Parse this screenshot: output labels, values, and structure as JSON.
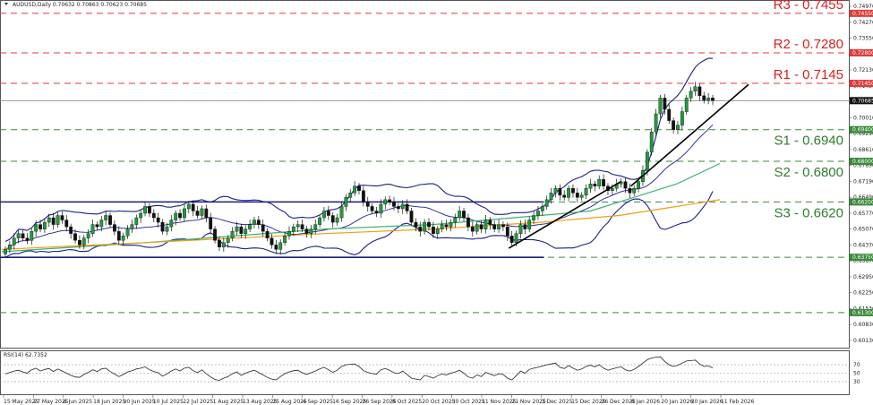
{
  "chart_data": {
    "type": "candlestick",
    "header": "AUDUSD,Daily  0.70632 0.70863 0.70623 0.70685",
    "ylim": [
      0.5975,
      0.751
    ],
    "y_ticks": [
      "0.74970",
      "0.74270",
      "0.73550",
      "0.72850",
      "0.72130",
      "0.71430",
      "0.70710",
      "0.70010",
      "0.69290",
      "0.68610",
      "0.67890",
      "0.67190",
      "0.66490",
      "0.65770",
      "0.65070",
      "0.64370",
      "0.63670",
      "0.62950",
      "0.62250",
      "0.61530",
      "0.60830",
      "0.60130"
    ],
    "x_ticks": [
      "15 May 2025",
      "27 May 2025",
      "6 Jun 2025",
      "18 Jun 2025",
      "30 Jun 2025",
      "10 Jul 2025",
      "22 Jul 2025",
      "1 Aug 2025",
      "13 Aug 2025",
      "25 Aug 2025",
      "4 Sep 2025",
      "16 Sep 2025",
      "26 Sep 2025",
      "8 Oct 2025",
      "20 Oct 2025",
      "30 Oct 2025",
      "11 Nov 2025",
      "21 Nov 2025",
      "3 Dec 2025",
      "15 Dec 2025",
      "26 Dec 2025",
      "8 Jan 2026",
      "20 Jan 2026",
      "30 Jan 2026",
      "11 Feb 2026"
    ],
    "current_price": {
      "value": 0.70685,
      "label": "0.70685"
    },
    "resistance": [
      {
        "name": "R3 - 0.7455",
        "value": 0.7455,
        "tag": "0.74550"
      },
      {
        "name": "R2 - 0.7280",
        "value": 0.728,
        "tag": "0.72800"
      },
      {
        "name": "R1 - 0.7145",
        "value": 0.7145,
        "tag": "0.71450"
      }
    ],
    "support": [
      {
        "name": "S1 - 0.6940",
        "value": 0.694,
        "tag": "0.69400"
      },
      {
        "name": "S2 - 0.6800",
        "value": 0.68,
        "tag": "0.68000"
      },
      {
        "name": "S3 - 0.6620",
        "value": 0.662,
        "tag": "0.66200"
      }
    ],
    "extra_levels": [
      {
        "value": 0.6375,
        "tag": "0.63750"
      },
      {
        "value": 0.613,
        "tag": "0.61300"
      }
    ],
    "range_lines": [
      0.662,
      0.6375
    ],
    "close_series": [
      0.641,
      0.643,
      0.646,
      0.648,
      0.646,
      0.645,
      0.649,
      0.652,
      0.65,
      0.653,
      0.655,
      0.652,
      0.656,
      0.654,
      0.651,
      0.648,
      0.645,
      0.643,
      0.646,
      0.648,
      0.652,
      0.651,
      0.654,
      0.656,
      0.652,
      0.649,
      0.645,
      0.647,
      0.65,
      0.652,
      0.655,
      0.657,
      0.66,
      0.657,
      0.655,
      0.653,
      0.649,
      0.651,
      0.654,
      0.657,
      0.655,
      0.659,
      0.661,
      0.658,
      0.656,
      0.659,
      0.655,
      0.65,
      0.645,
      0.642,
      0.644,
      0.646,
      0.649,
      0.651,
      0.648,
      0.65,
      0.652,
      0.654,
      0.652,
      0.649,
      0.646,
      0.643,
      0.641,
      0.644,
      0.647,
      0.649,
      0.651,
      0.652,
      0.65,
      0.648,
      0.65,
      0.652,
      0.655,
      0.658,
      0.656,
      0.653,
      0.655,
      0.66,
      0.664,
      0.666,
      0.669,
      0.667,
      0.662,
      0.66,
      0.658,
      0.657,
      0.661,
      0.663,
      0.662,
      0.66,
      0.659,
      0.661,
      0.658,
      0.653,
      0.651,
      0.649,
      0.653,
      0.651,
      0.648,
      0.65,
      0.652,
      0.651,
      0.653,
      0.655,
      0.658,
      0.655,
      0.651,
      0.649,
      0.652,
      0.65,
      0.654,
      0.652,
      0.65,
      0.652,
      0.651,
      0.647,
      0.644,
      0.648,
      0.652,
      0.65,
      0.654,
      0.656,
      0.658,
      0.66,
      0.663,
      0.666,
      0.668,
      0.665,
      0.664,
      0.668,
      0.666,
      0.664,
      0.665,
      0.668,
      0.67,
      0.669,
      0.672,
      0.669,
      0.667,
      0.668,
      0.67,
      0.671,
      0.668,
      0.666,
      0.668,
      0.671,
      0.676,
      0.684,
      0.693,
      0.701,
      0.708,
      0.703,
      0.698,
      0.694,
      0.696,
      0.702,
      0.708,
      0.711,
      0.713,
      0.709,
      0.707,
      0.708,
      0.7069
    ],
    "ma_orange": [
      [
        0,
        0.641
      ],
      [
        0.2,
        0.644
      ],
      [
        0.45,
        0.648
      ],
      [
        0.6,
        0.65
      ],
      [
        0.75,
        0.653
      ],
      [
        0.86,
        0.656
      ],
      [
        0.94,
        0.66
      ],
      [
        1,
        0.663
      ]
    ],
    "ma_green": [
      [
        0,
        0.64
      ],
      [
        0.2,
        0.644
      ],
      [
        0.45,
        0.65
      ],
      [
        0.6,
        0.652
      ],
      [
        0.75,
        0.656
      ],
      [
        0.82,
        0.658
      ],
      [
        0.88,
        0.664
      ],
      [
        0.94,
        0.67
      ],
      [
        1,
        0.679
      ]
    ],
    "trendlines": [
      {
        "from": [
          0.706,
          0.6415
        ],
        "to": [
          0.862,
          0.671
        ]
      },
      {
        "from": [
          0.876,
          0.669
        ],
        "to": [
          1.04,
          0.714
        ]
      }
    ],
    "rsi": {
      "label": "RSI(14) 62.7352",
      "ylim": [
        0,
        100
      ],
      "levels": [
        70,
        50,
        30
      ],
      "ticks": [
        "70",
        "50",
        "30"
      ],
      "values": [
        48,
        52,
        55,
        57,
        53,
        50,
        58,
        62,
        55,
        59,
        61,
        54,
        60,
        55,
        50,
        45,
        41,
        40,
        47,
        52,
        58,
        54,
        60,
        62,
        54,
        48,
        42,
        47,
        53,
        56,
        60,
        62,
        65,
        58,
        54,
        51,
        43,
        48,
        55,
        60,
        55,
        62,
        64,
        56,
        51,
        58,
        49,
        41,
        35,
        33,
        38,
        42,
        49,
        53,
        45,
        50,
        54,
        57,
        52,
        46,
        40,
        36,
        34,
        42,
        49,
        53,
        56,
        57,
        51,
        47,
        51,
        55,
        60,
        64,
        58,
        52,
        57,
        66,
        70,
        71,
        72,
        66,
        56,
        52,
        49,
        48,
        58,
        61,
        57,
        51,
        49,
        55,
        47,
        38,
        36,
        34,
        45,
        42,
        38,
        44,
        48,
        46,
        50,
        53,
        57,
        50,
        41,
        38,
        46,
        42,
        52,
        48,
        44,
        49,
        47,
        38,
        34,
        44,
        55,
        50,
        59,
        62,
        64,
        67,
        70,
        72,
        74,
        64,
        61,
        68,
        62,
        57,
        60,
        66,
        69,
        65,
        70,
        62,
        57,
        60,
        63,
        65,
        58,
        55,
        59,
        66,
        74,
        82,
        86,
        88,
        89,
        78,
        70,
        66,
        69,
        74,
        79,
        80,
        81,
        72,
        66,
        67,
        62.7
      ]
    }
  }
}
